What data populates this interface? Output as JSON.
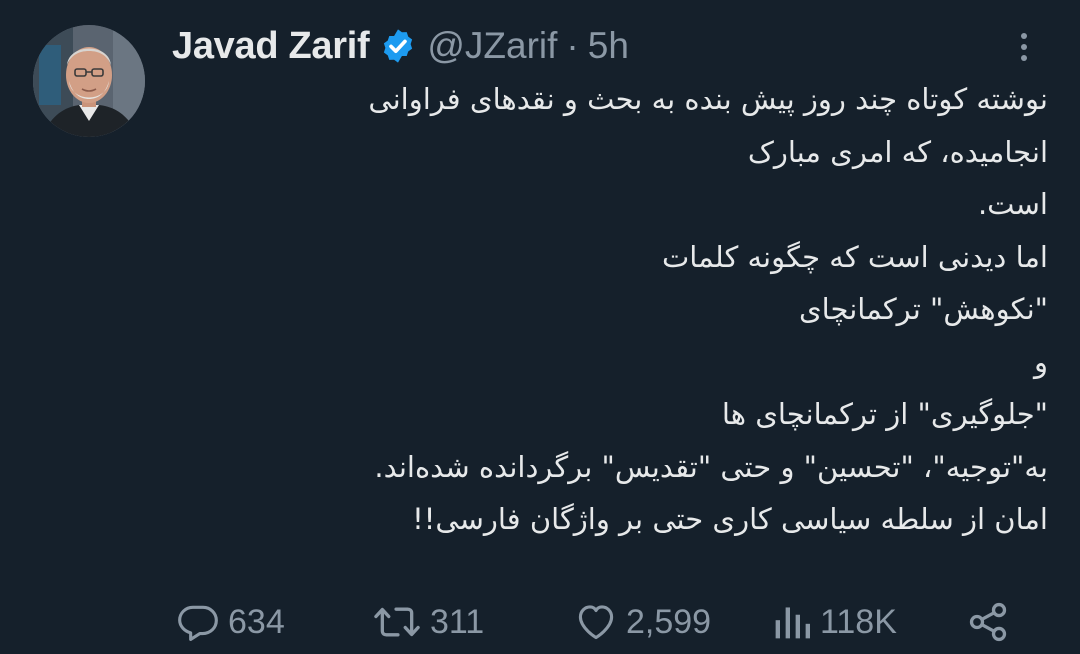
{
  "tweet": {
    "author": {
      "display_name": "Javad Zarif",
      "handle": "@JZarif",
      "separator": "·",
      "time": "5h",
      "avatar_icon": "profile-photo",
      "verified_icon": "verified-badge-icon"
    },
    "body_lines": [
      "نوشته کوتاه چند روز پیش بنده به بحث و نقدهای فراوانی",
      "انجامیده، که امری مبارک",
      "است.",
      "اما دیدنی است که چگونه  کلمات",
      "\"نکوهش\" ترکمانچای",
      "و",
      "\"جلوگیری\" از ترکمانچای ها",
      "به\"توجیه\"، \"تحسین\" و حتی \"تقدیس\" برگردانده شده‌اند.",
      "امان از سلطه سیاسی کاری حتی بر واژگان فارسی!!"
    ],
    "actions": {
      "replies": "634",
      "retweets": "311",
      "likes": "2,599",
      "views": "118K"
    }
  },
  "colors": {
    "background": "#15202b",
    "text": "#e7e9ea",
    "muted": "#8b98a5",
    "verified": "#1d9bf0"
  }
}
